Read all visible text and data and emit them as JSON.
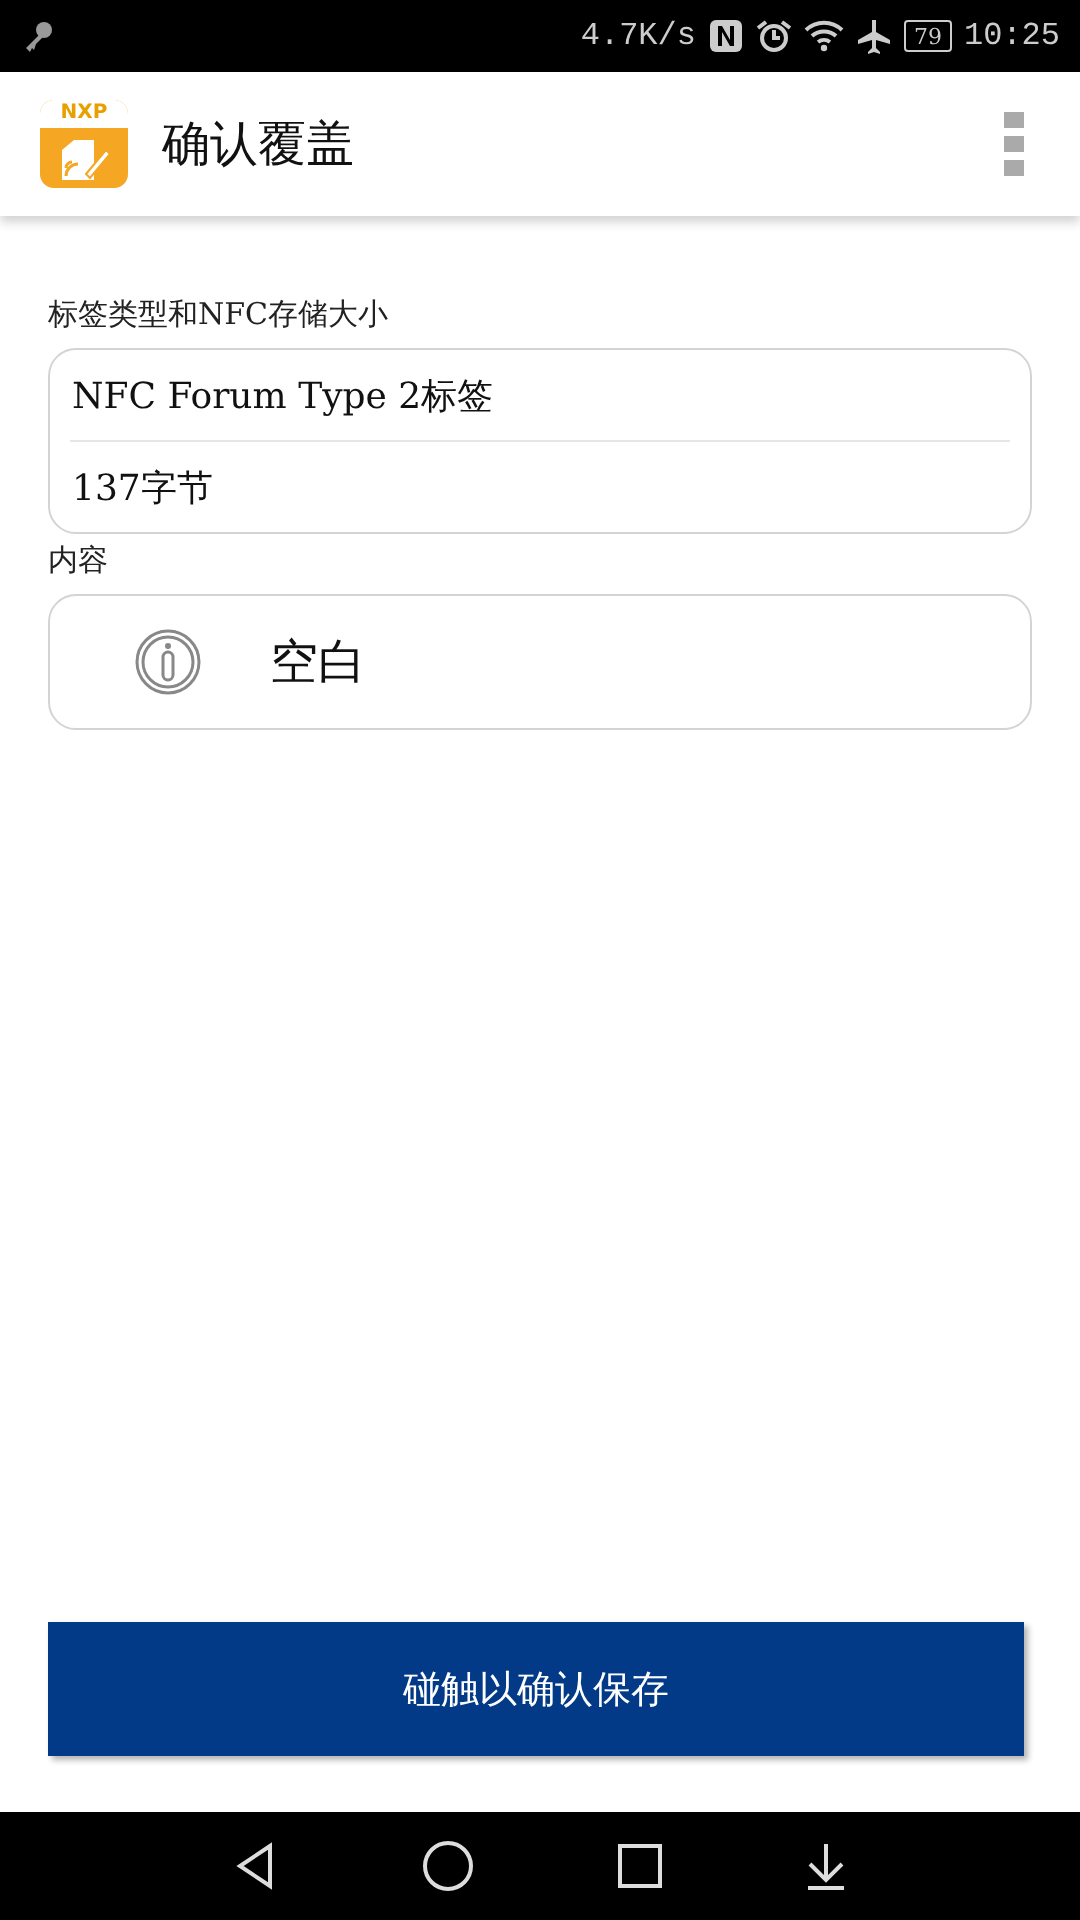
{
  "status_bar": {
    "net_speed": "4.7K/s",
    "battery": "79",
    "time": "10:25"
  },
  "app_bar": {
    "logo_text": "NXP",
    "title": "确认覆盖"
  },
  "tag_section": {
    "label": "标签类型和NFC存储大小",
    "type": "NFC Forum Type 2标签",
    "size": "137字节"
  },
  "content_section": {
    "label": "内容",
    "value": "空白"
  },
  "action_button": "碰触以确认保存"
}
